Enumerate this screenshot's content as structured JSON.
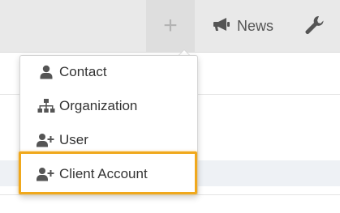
{
  "toolbar": {
    "plus_label": "+",
    "news_label": "News"
  },
  "dropdown": {
    "items": [
      {
        "label": "Contact",
        "icon": "user-icon"
      },
      {
        "label": "Organization",
        "icon": "sitemap-icon"
      },
      {
        "label": "User",
        "icon": "user-plus-icon"
      },
      {
        "label": "Client Account",
        "icon": "user-plus-icon"
      }
    ]
  },
  "colors": {
    "highlight": "#f0a81c",
    "topbar": "#e9e9e9",
    "icon": "#555555"
  }
}
